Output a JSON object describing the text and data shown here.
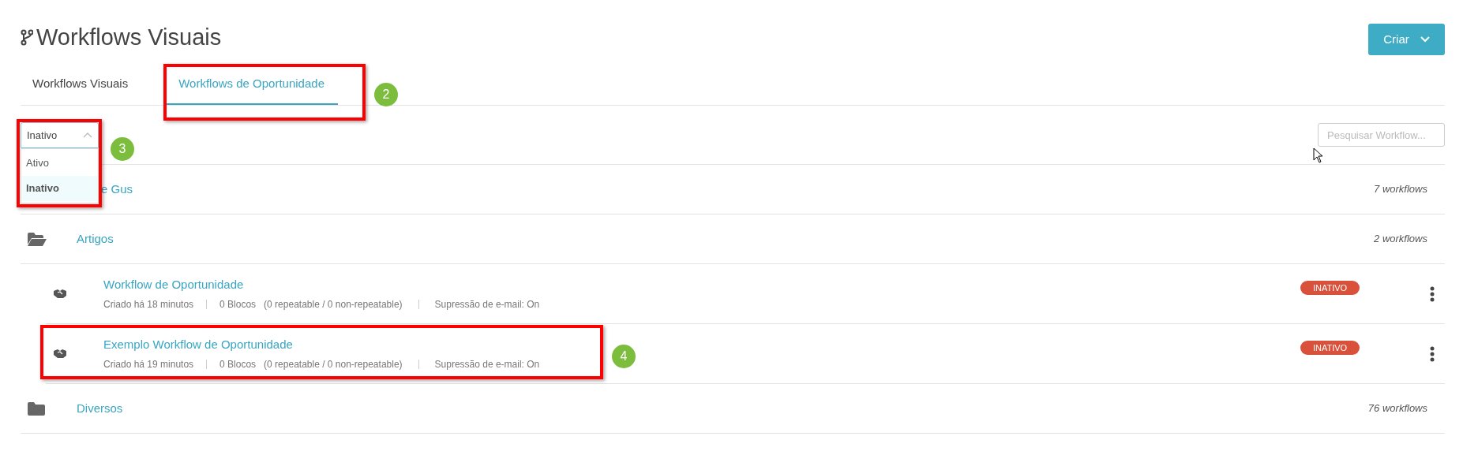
{
  "header": {
    "title": "Workflows Visuais",
    "create_button": "Criar"
  },
  "tabs": [
    {
      "label": "Workflows Visuais",
      "selected": false
    },
    {
      "label": "Workflows de Oportunidade",
      "selected": true
    }
  ],
  "status_filter": {
    "value": "Inativo",
    "expanded": true,
    "options": [
      {
        "label": "Ativo",
        "selected": false
      },
      {
        "label": "Inativo",
        "selected": true
      }
    ]
  },
  "search": {
    "placeholder": "Pesquisar Workflow..."
  },
  "folders": [
    {
      "name": "e Gus",
      "count": "7 workflows"
    },
    {
      "name": "Artigos",
      "count": "2 workflows",
      "expanded": true,
      "children": [
        {
          "name": "Workflow de Oportunidade",
          "created": "Criado há 18 minutos",
          "blocks": "0 Blocos",
          "repeat": "(0 repeatable / 0 non-repeatable)",
          "suppression": "Supressão de e-mail: On",
          "status": "INATIVO",
          "active": false
        },
        {
          "name": "Exemplo Workflow de Oportunidade",
          "created": "Criado há 19 minutos",
          "blocks": "0 Blocos",
          "repeat": "(0 repeatable / 0 non-repeatable)",
          "suppression": "Supressão de e-mail: On",
          "status": "INATIVO",
          "active": false
        }
      ]
    },
    {
      "name": "Diversos",
      "count": "76 workflows",
      "expanded": false
    }
  ],
  "annotations": [
    {
      "number": "2"
    },
    {
      "number": "3"
    },
    {
      "number": "4"
    }
  ]
}
